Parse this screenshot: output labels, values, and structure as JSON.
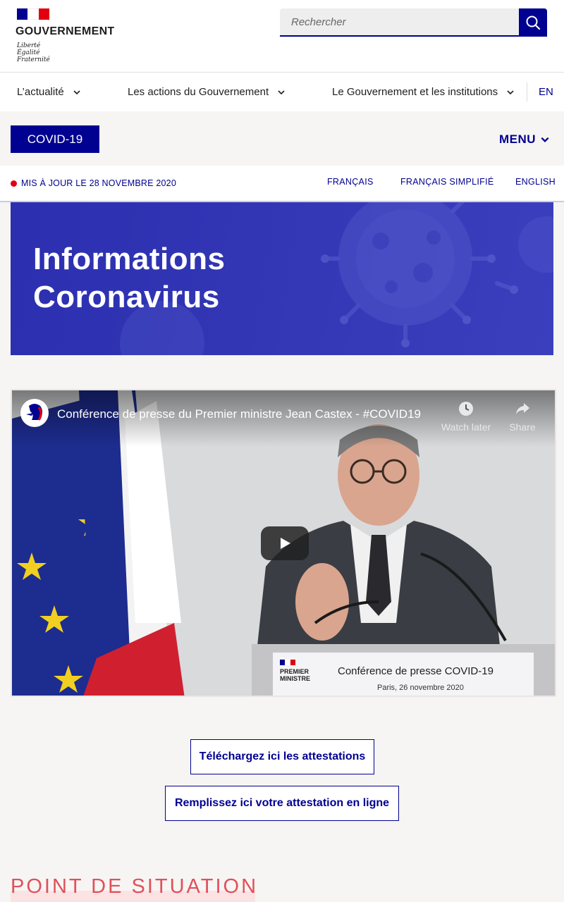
{
  "header": {
    "logo_title": "GOUVERNEMENT",
    "motto": [
      "Liberté",
      "Égalité",
      "Fraternité"
    ],
    "search_placeholder": "Rechercher",
    "brand_blue": "#000091",
    "brand_red": "#e1000f"
  },
  "nav": {
    "items": [
      {
        "label": "L’actualité"
      },
      {
        "label": "Les actions du Gouvernement"
      },
      {
        "label": "Le Gouvernement et les institutions"
      }
    ],
    "lang_switch": "EN"
  },
  "covid_bar": {
    "button": "COVID-19",
    "menu": "MENU"
  },
  "update_bar": {
    "text": "MIS À JOUR LE 28 NOVEMBRE 2020",
    "languages": [
      "FRANÇAIS",
      "FRANÇAIS SIMPLIFIÉ",
      "ENGLISH"
    ]
  },
  "hero": {
    "title_line1": "Informations",
    "title_line2": "Coronavirus"
  },
  "video": {
    "title": "Conférence de presse du Premier ministre Jean Castex - #COVID19",
    "watch_later": "Watch later",
    "share": "Share",
    "lectern_org": [
      "PREMIER",
      "MINISTRE"
    ],
    "lectern_title": "Conférence de presse COVID-19",
    "lectern_subtitle": "Paris, 26 novembre 2020"
  },
  "buttons": {
    "download": "Téléchargez ici les attestations",
    "fill_online": "Remplissez ici votre attestation en ligne"
  },
  "section": {
    "title": "POINT DE SITUATION"
  }
}
